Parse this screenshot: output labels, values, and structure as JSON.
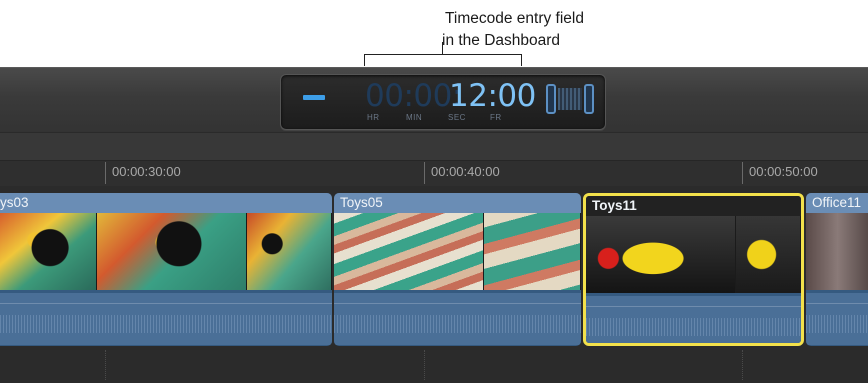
{
  "annotation": {
    "line1": "Timecode entry field",
    "line2": "in the Dashboard"
  },
  "dashboard": {
    "timecode_dim": "00:00:",
    "timecode_bright": "12:00",
    "units": [
      "HR",
      "MIN",
      "SEC",
      "FR"
    ],
    "accent_color": "#3d9ee8",
    "icons": [
      "minus-icon",
      "filmstrip-icon"
    ]
  },
  "ruler": {
    "labels": [
      "00:00:30:00",
      "00:00:40:00",
      "00:00:50:00"
    ]
  },
  "clips": [
    {
      "name": "ys03",
      "selected": false
    },
    {
      "name": "Toys05",
      "selected": false
    },
    {
      "name": "Toys11",
      "selected": true
    },
    {
      "name": "Office11",
      "selected": false
    }
  ],
  "colors": {
    "selection": "#f3e14b",
    "clip_header": "#6a8db5",
    "audio": "#4a6f97"
  }
}
